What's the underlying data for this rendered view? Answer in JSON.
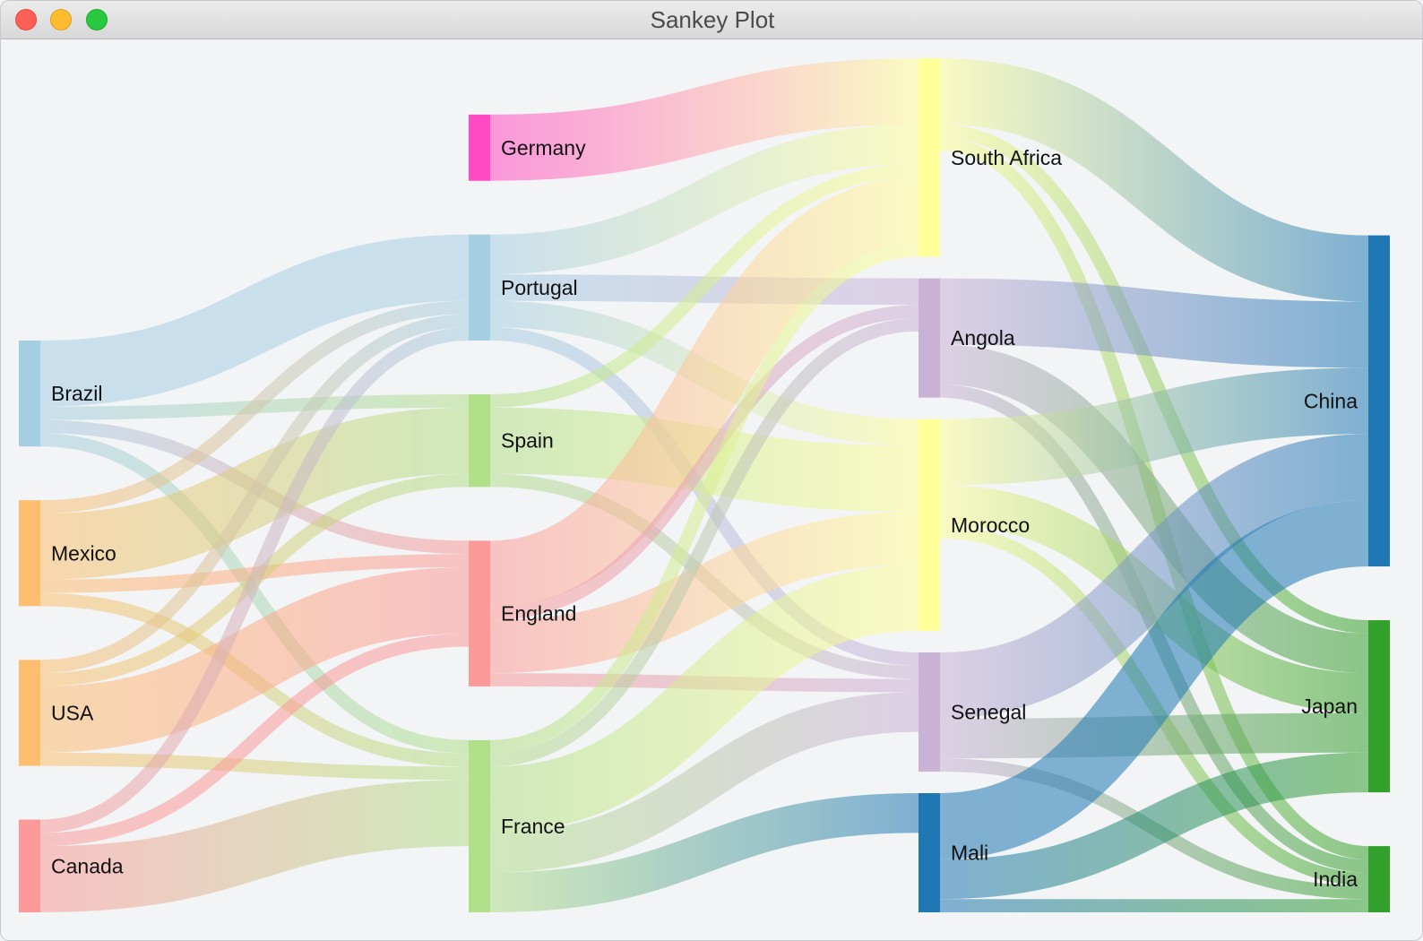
{
  "window": {
    "title": "Sankey Plot"
  },
  "chart_data": {
    "type": "sankey",
    "nodes": [
      {
        "id": "Brazil",
        "label": "Brazil",
        "column": 0,
        "color": "#a6cee3"
      },
      {
        "id": "Mexico",
        "label": "Mexico",
        "column": 0,
        "color": "#fdbf6f"
      },
      {
        "id": "USA",
        "label": "USA",
        "column": 0,
        "color": "#fdbf6f"
      },
      {
        "id": "Canada",
        "label": "Canada",
        "column": 0,
        "color": "#fb9a99"
      },
      {
        "id": "Germany",
        "label": "Germany",
        "column": 1,
        "color": "#ff4ac4"
      },
      {
        "id": "Portugal",
        "label": "Portugal",
        "column": 1,
        "color": "#a6cee3"
      },
      {
        "id": "Spain",
        "label": "Spain",
        "column": 1,
        "color": "#b2df8a"
      },
      {
        "id": "England",
        "label": "England",
        "column": 1,
        "color": "#fb9a99"
      },
      {
        "id": "France",
        "label": "France",
        "column": 1,
        "color": "#b2df8a"
      },
      {
        "id": "South Africa",
        "label": "South Africa",
        "column": 2,
        "color": "#ffff99"
      },
      {
        "id": "Angola",
        "label": "Angola",
        "column": 2,
        "color": "#cab2d6"
      },
      {
        "id": "Morocco",
        "label": "Morocco",
        "column": 2,
        "color": "#ffff99"
      },
      {
        "id": "Senegal",
        "label": "Senegal",
        "column": 2,
        "color": "#cab2d6"
      },
      {
        "id": "Mali",
        "label": "Mali",
        "column": 2,
        "color": "#1f78b4"
      },
      {
        "id": "China",
        "label": "China",
        "column": 3,
        "color": "#1f78b4"
      },
      {
        "id": "Japan",
        "label": "Japan",
        "column": 3,
        "color": "#33a02c"
      },
      {
        "id": "India",
        "label": "India",
        "column": 3,
        "color": "#33a02c"
      }
    ],
    "links": [
      {
        "source": "Brazil",
        "target": "Portugal",
        "value": 5
      },
      {
        "source": "Brazil",
        "target": "Spain",
        "value": 1
      },
      {
        "source": "Brazil",
        "target": "England",
        "value": 1
      },
      {
        "source": "Brazil",
        "target": "France",
        "value": 1
      },
      {
        "source": "Mexico",
        "target": "Portugal",
        "value": 1
      },
      {
        "source": "Mexico",
        "target": "Spain",
        "value": 5
      },
      {
        "source": "Mexico",
        "target": "England",
        "value": 1
      },
      {
        "source": "Mexico",
        "target": "France",
        "value": 1
      },
      {
        "source": "USA",
        "target": "Portugal",
        "value": 1
      },
      {
        "source": "USA",
        "target": "Spain",
        "value": 1
      },
      {
        "source": "USA",
        "target": "England",
        "value": 5
      },
      {
        "source": "USA",
        "target": "France",
        "value": 1
      },
      {
        "source": "Canada",
        "target": "Portugal",
        "value": 1
      },
      {
        "source": "Canada",
        "target": "England",
        "value": 1
      },
      {
        "source": "Canada",
        "target": "France",
        "value": 5
      },
      {
        "source": "Germany",
        "target": "South Africa",
        "value": 5
      },
      {
        "source": "Portugal",
        "target": "South Africa",
        "value": 3
      },
      {
        "source": "Portugal",
        "target": "Angola",
        "value": 2
      },
      {
        "source": "Portugal",
        "target": "Morocco",
        "value": 2
      },
      {
        "source": "Portugal",
        "target": "Senegal",
        "value": 1
      },
      {
        "source": "Spain",
        "target": "South Africa",
        "value": 1
      },
      {
        "source": "Spain",
        "target": "Morocco",
        "value": 5
      },
      {
        "source": "Spain",
        "target": "Senegal",
        "value": 1
      },
      {
        "source": "England",
        "target": "South Africa",
        "value": 5
      },
      {
        "source": "England",
        "target": "Angola",
        "value": 1
      },
      {
        "source": "England",
        "target": "Morocco",
        "value": 4
      },
      {
        "source": "England",
        "target": "Senegal",
        "value": 1
      },
      {
        "source": "France",
        "target": "South Africa",
        "value": 1
      },
      {
        "source": "France",
        "target": "Angola",
        "value": 1
      },
      {
        "source": "France",
        "target": "Morocco",
        "value": 5
      },
      {
        "source": "France",
        "target": "Senegal",
        "value": 3
      },
      {
        "source": "France",
        "target": "Mali",
        "value": 3
      },
      {
        "source": "South Africa",
        "target": "China",
        "value": 5
      },
      {
        "source": "South Africa",
        "target": "Japan",
        "value": 1
      },
      {
        "source": "South Africa",
        "target": "India",
        "value": 1
      },
      {
        "source": "Angola",
        "target": "China",
        "value": 5
      },
      {
        "source": "Angola",
        "target": "Japan",
        "value": 3
      },
      {
        "source": "Angola",
        "target": "India",
        "value": 1
      },
      {
        "source": "Morocco",
        "target": "China",
        "value": 5
      },
      {
        "source": "Morocco",
        "target": "Japan",
        "value": 3
      },
      {
        "source": "Morocco",
        "target": "India",
        "value": 1
      },
      {
        "source": "Senegal",
        "target": "China",
        "value": 5
      },
      {
        "source": "Senegal",
        "target": "Japan",
        "value": 3
      },
      {
        "source": "Senegal",
        "target": "India",
        "value": 1
      },
      {
        "source": "Mali",
        "target": "China",
        "value": 5
      },
      {
        "source": "Mali",
        "target": "Japan",
        "value": 3
      },
      {
        "source": "Mali",
        "target": "India",
        "value": 1
      }
    ]
  }
}
